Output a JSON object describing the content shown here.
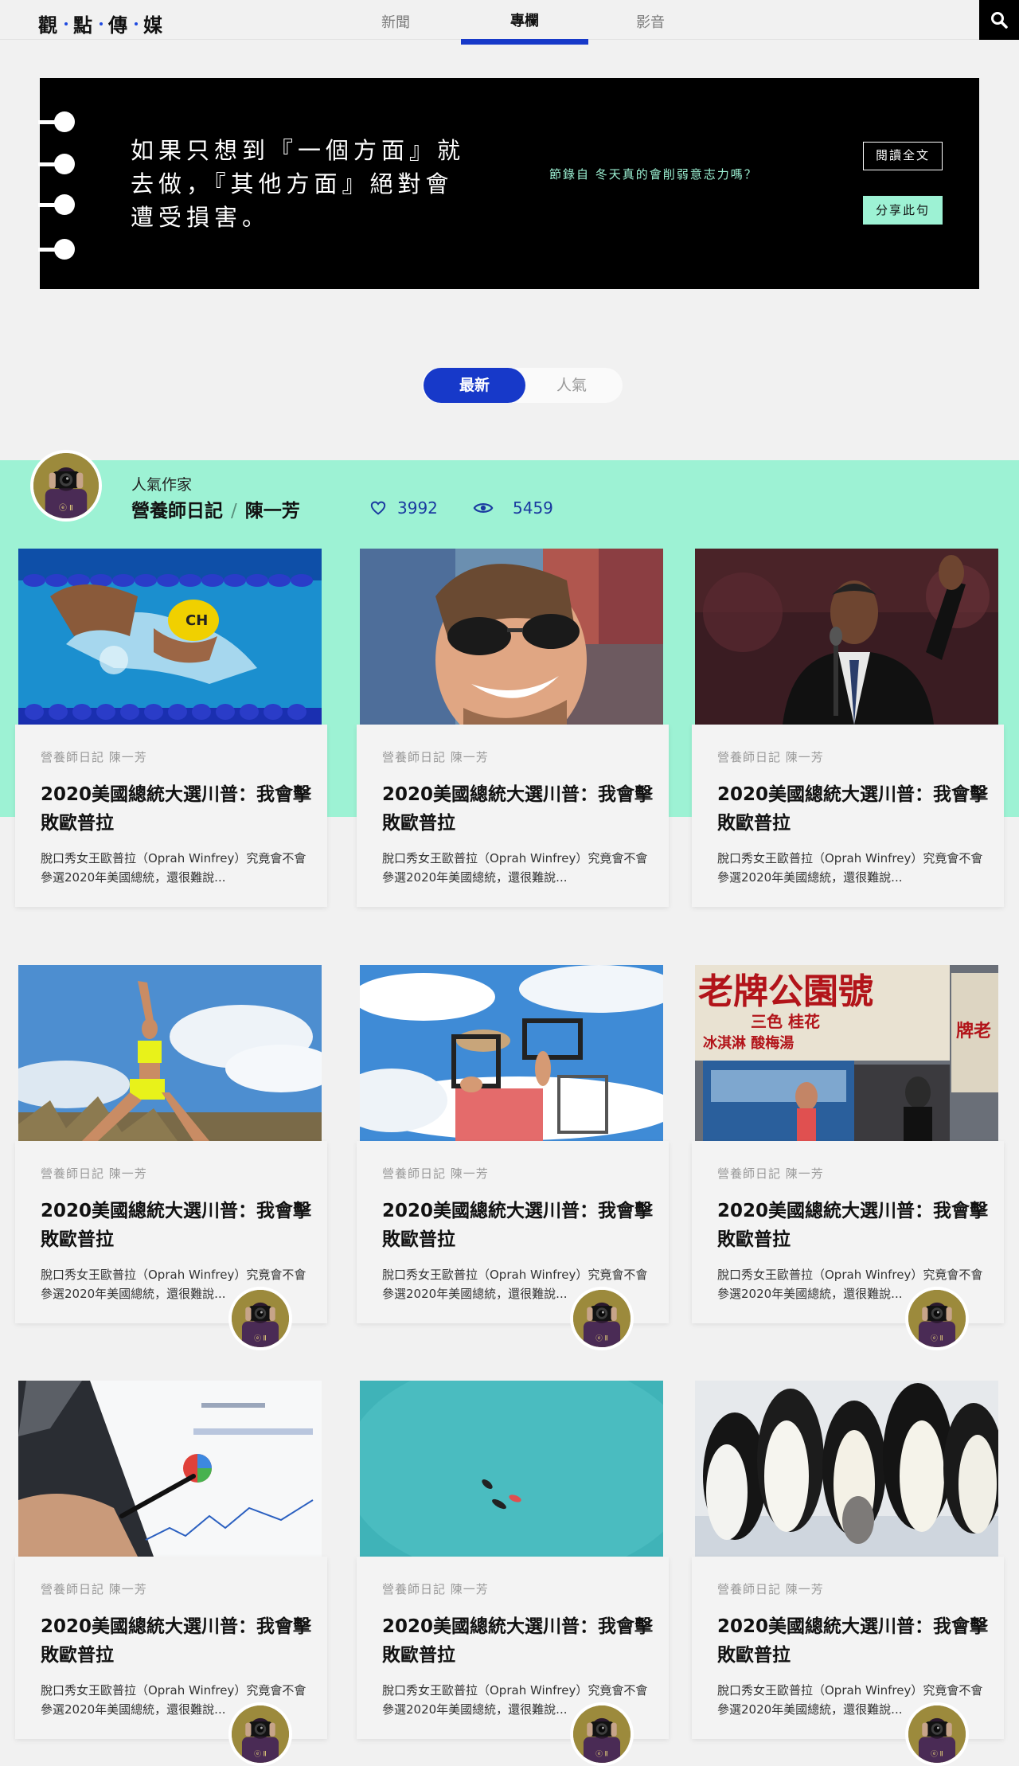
{
  "header": {
    "logo_chars": [
      "觀",
      "點",
      "傳",
      "媒"
    ],
    "nav": [
      {
        "label": "新聞",
        "active": false
      },
      {
        "label": "專欄",
        "active": true
      },
      {
        "label": "影音",
        "active": false
      }
    ],
    "search_icon": "search-icon"
  },
  "quote": {
    "text": "如果只想到『一個方面』就去做，『其他方面』絕對會遭受損害。",
    "source": "節錄自 冬天真的會削弱意志力嗎？",
    "read_label": "閱讀全文",
    "share_label": "分享此句"
  },
  "toggle": {
    "latest": "最新",
    "popular": "人氣"
  },
  "author": {
    "tag": "人氣作家",
    "column": "營養師日記",
    "separator": "/",
    "name": "陳一芳",
    "likes": "3992",
    "views": "5459"
  },
  "cards": [
    {
      "meta": "營養師日記 陳一芳",
      "title": "2020美國總統大選川普：我會擊敗歐普拉",
      "excerpt": "脫口秀女王歐普拉（Oprah Winfrey）究竟會不會參選2020年美國總統，還很難說...",
      "image": "swimmer"
    },
    {
      "meta": "營養師日記 陳一芳",
      "title": "2020美國總統大選川普：我會擊敗歐普拉",
      "excerpt": "脫口秀女王歐普拉（Oprah Winfrey）究竟會不會參選2020年美國總統，還很難說...",
      "image": "smiling-man"
    },
    {
      "meta": "營養師日記 陳一芳",
      "title": "2020美國總統大選川普：我會擊敗歐普拉",
      "excerpt": "脫口秀女王歐普拉（Oprah Winfrey）究竟會不會參選2020年美國總統，還很難說...",
      "image": "speaker"
    },
    {
      "meta": "營養師日記 陳一芳",
      "title": "2020美國總統大選川普：我會擊敗歐普拉",
      "excerpt": "脫口秀女王歐普拉（Oprah Winfrey）究竟會不會參選2020年美國總統，還很難說...",
      "image": "runner"
    },
    {
      "meta": "營養師日記 陳一芳",
      "title": "2020美國總統大選川普：我會擊敗歐普拉",
      "excerpt": "脫口秀女王歐普拉（Oprah Winfrey）究竟會不會參選2020年美國總統，還很難說...",
      "image": "frames"
    },
    {
      "meta": "營養師日記 陳一芳",
      "title": "2020美國總統大選川普：我會擊敗歐普拉",
      "excerpt": "脫口秀女王歐普拉（Oprah Winfrey）究竟會不會參選2020年美國總統，還很難說...",
      "image": "shop"
    },
    {
      "meta": "營養師日記 陳一芳",
      "title": "2020美國總統大選川普：我會擊敗歐普拉",
      "excerpt": "脫口秀女王歐普拉（Oprah Winfrey）究竟會不會參選2020年美國總統，還很難說...",
      "image": "tablet"
    },
    {
      "meta": "營養師日記 陳一芳",
      "title": "2020美國總統大選川普：我會擊敗歐普拉",
      "excerpt": "脫口秀女王歐普拉（Oprah Winfrey）究竟會不會參選2020年美國總統，還很難說...",
      "image": "sea"
    },
    {
      "meta": "營養師日記 陳一芳",
      "title": "2020美國總統大選川普：我會擊敗歐普拉",
      "excerpt": "脫口秀女王歐普拉（Oprah Winfrey）究竟會不會參選2020年美國總統，還很難說...",
      "image": "penguins"
    }
  ],
  "shop_sign": {
    "main": "老牌公園號",
    "sub": "三色 桂花",
    "sub2": "冰淇淋 酸梅湯",
    "side": "牌老"
  },
  "colors": {
    "accent": "#1739c9",
    "mint": "#9df2d4",
    "banner_bg": "#000000",
    "page_bg": "#f1f1f1"
  }
}
